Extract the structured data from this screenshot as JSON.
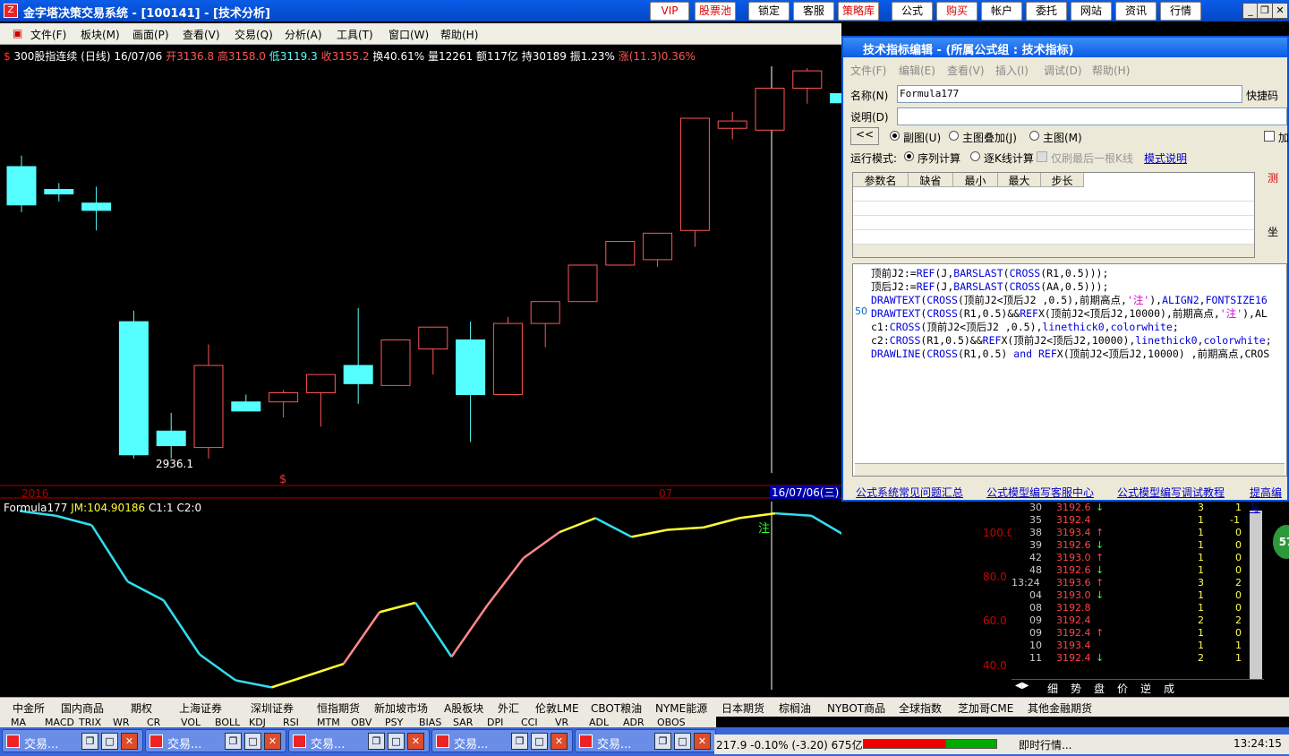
{
  "titlebar": {
    "app_icon": "Z",
    "title": "金字塔决策交易系统 - [100141] - [技术分析]",
    "buttons": [
      "VIP",
      "股票池",
      "锁定",
      "客服",
      "策略库",
      "公式",
      "购买",
      "帐户",
      "委托",
      "网站",
      "资讯",
      "行情"
    ]
  },
  "menu": {
    "items": [
      "文件(F)",
      "板块(M)",
      "画面(P)",
      "查看(V)",
      "交易(Q)",
      "分析(A)",
      "工具(T)",
      "窗口(W)",
      "帮助(H)"
    ]
  },
  "chart": {
    "info": {
      "flag": "$",
      "name": "300股指连续 (日线) 16/07/06",
      "open": "开3136.8",
      "high": "高3158.0",
      "low": "低3119.3",
      "close": "收3155.2",
      "turnover": "换40.61%",
      "volume": "量12261",
      "amount": "额117亿",
      "position": "持30189",
      "amplitude": "振1.23%",
      "change": "涨(11.3)0.36%"
    },
    "low_label": "2936.1",
    "signal_mark": "$",
    "year_label": "2016",
    "month_label": "07",
    "date_label": "16/07/06(三)",
    "indicator": {
      "name": "Formula177",
      "jm": "JM:104.90186",
      "c1": "C1:1",
      "c2": "C2:0",
      "note": "注"
    },
    "y_ticks": [
      "100.0",
      "80.0",
      "60.0",
      "40.0"
    ],
    "colors": {
      "up": "#ff5555",
      "down": "#55ffff",
      "line_cyan": "#33ddee",
      "line_pink": "#ff8888",
      "line_yellow": "#ffff33"
    }
  },
  "chart_data": {
    "type": "candlestick",
    "x": [
      "c1",
      "c2",
      "c3",
      "c4",
      "c5",
      "c6",
      "c7",
      "c8",
      "c9",
      "c10",
      "c11",
      "c12",
      "c13",
      "c14",
      "c15",
      "c16",
      "c17",
      "c18",
      "c19",
      "c20",
      "c21",
      "c22",
      "c23"
    ],
    "ohlc": [
      [
        3050,
        3062,
        3000,
        3008
      ],
      [
        3025,
        3032,
        3012,
        3020
      ],
      [
        3010,
        3028,
        2980,
        3002
      ],
      [
        2880,
        2892,
        2730,
        2734
      ],
      [
        2760,
        2780,
        2730,
        2744
      ],
      [
        2742,
        2855,
        2730,
        2832
      ],
      [
        2792,
        2800,
        2782,
        2782
      ],
      [
        2792,
        2805,
        2775,
        2802
      ],
      [
        2802,
        2820,
        2765,
        2822
      ],
      [
        2832,
        2895,
        2790,
        2812
      ],
      [
        2810,
        2860,
        2810,
        2860
      ],
      [
        2850,
        2862,
        2822,
        2874
      ],
      [
        2860,
        2880,
        2748,
        2800
      ],
      [
        2800,
        2885,
        2800,
        2878
      ],
      [
        2878,
        2898,
        2852,
        2902
      ],
      [
        2902,
        2925,
        2902,
        2942
      ],
      [
        2942,
        2966,
        2950,
        2968
      ],
      [
        2948,
        2972,
        2940,
        2977
      ],
      [
        2980,
        3006,
        2962,
        3103
      ],
      [
        3092,
        3110,
        3080,
        3100
      ],
      [
        3090,
        3113,
        3090,
        3136
      ],
      [
        3136,
        3158,
        3119,
        3155
      ],
      [
        3130,
        3132,
        3120,
        3120
      ]
    ],
    "indicator_series": [
      {
        "name": "Formula177",
        "values": [
          106,
          104,
          100,
          76,
          68,
          45,
          34,
          31,
          36,
          41,
          63,
          67,
          44,
          66,
          86,
          97,
          103,
          95,
          98,
          99,
          103,
          105,
          104,
          95,
          72,
          81
        ]
      }
    ],
    "ylim_indicator": [
      30,
      110
    ]
  },
  "ticks": {
    "rows": [
      {
        "t": "30",
        "p": "3192.6",
        "a": "↓",
        "v": "3",
        "d": "1"
      },
      {
        "t": "35",
        "p": "3192.4",
        "a": "",
        "v": "1",
        "d": "-1"
      },
      {
        "t": "38",
        "p": "3193.4",
        "a": "↑",
        "v": "1",
        "d": "0"
      },
      {
        "t": "39",
        "p": "3192.6",
        "a": "↓",
        "v": "1",
        "d": "0"
      },
      {
        "t": "42",
        "p": "3193.0",
        "a": "↑",
        "v": "1",
        "d": "0"
      },
      {
        "t": "48",
        "p": "3192.6",
        "a": "↓",
        "v": "1",
        "d": "0"
      },
      {
        "t": "13:24",
        "p": "3193.6",
        "a": "↑",
        "v": "3",
        "d": "2"
      },
      {
        "t": "04",
        "p": "3193.0",
        "a": "↓",
        "v": "1",
        "d": "0"
      },
      {
        "t": "08",
        "p": "3192.8",
        "a": "",
        "v": "1",
        "d": "0"
      },
      {
        "t": "09",
        "p": "3192.4",
        "a": "",
        "v": "2",
        "d": "2"
      },
      {
        "t": "09",
        "p": "3192.4",
        "a": "↑",
        "v": "1",
        "d": "0"
      },
      {
        "t": "10",
        "p": "3193.4",
        "a": "",
        "v": "1",
        "d": "1"
      },
      {
        "t": "11",
        "p": "3192.4",
        "a": "↓",
        "v": "2",
        "d": "1"
      }
    ],
    "tabs": [
      "细",
      "势",
      "盘",
      "价",
      "逆",
      "成"
    ],
    "badge": "57"
  },
  "tabs": [
    "中金所",
    "国内商品",
    "期权",
    "上海证券",
    "深圳证券",
    "恒指期货",
    "新加坡市场",
    "A股板块",
    "外汇",
    "伦敦LME",
    "CBOT粮油",
    "NYME能源",
    "日本期货",
    "棕榈油",
    "NYBOT商品",
    "全球指数",
    "芝加哥CME",
    "其他金融期货"
  ],
  "indicators_bar": [
    "MA",
    "MACD",
    "TRIX",
    "WR",
    "CR",
    "VOL",
    "BOLL",
    "KDJ",
    "RSI",
    "MTM",
    "OBV",
    "PSY",
    "BIAS",
    "SAR",
    "DPI",
    "CCI",
    "VR",
    "ADL",
    "ADR",
    "OBOS"
  ],
  "taskbar": {
    "items": [
      "交易...",
      "交易...",
      "交易...",
      "交易...",
      "交易..."
    ]
  },
  "status": {
    "quote": "217.9 -0.10% (-3.20) 675亿",
    "realtime": "即时行情...",
    "clock": "13:24:15"
  },
  "editor": {
    "title": "技术指标编辑 - (所属公式组 : 技术指标)",
    "menu": [
      "文件(F)",
      "编辑(E)",
      "查看(V)",
      "插入(I)",
      "调试(D)",
      "帮助(H)"
    ],
    "name_label": "名称(N)",
    "name_value": "Formula177",
    "shortcut": "快捷码",
    "desc_label": "说明(D)",
    "back": "<<",
    "chart_types": [
      "副图(U)",
      "主图叠加(J)",
      "主图(M)"
    ],
    "add_label": "加",
    "run_mode": "运行模式:",
    "modes": [
      "序列计算",
      "逐K线计算"
    ],
    "last_bar": "仅刷最后一根K线",
    "mode_help": "模式说明",
    "param_headers": [
      "参数名",
      "缺省",
      "最小",
      "最大",
      "步长"
    ],
    "test": "测",
    "coord": "坐",
    "line_number": "50",
    "code": [
      "顶前J2:=REF(J,BARSLAST(CROSS(R1,0.5)));",
      "顶后J2:=REF(J,BARSLAST(CROSS(AA,0.5)));",
      "DRAWTEXT(CROSS(顶前J2<顶后J2 ,0.5),前期高点,'注'),ALIGN2,FONTSIZE16",
      "DRAWTEXT(CROSS(R1,0.5)&&REFX(顶前J2<顶后J2,10000),前期高点,'注'),AL",
      "c1:CROSS(顶前J2<顶后J2 ,0.5),linethick0,colorwhite;",
      "c2:CROSS(R1,0.5)&&REFX(顶前J2<顶后J2,10000),linethick0,colorwhite;",
      "DRAWLINE(CROSS(R1,0.5) and REFX(顶前J2<顶后J2,10000) ,前期高点,CROS"
    ],
    "links": [
      "公式系统常见问题汇总",
      "公式模型编写客服中心",
      "公式模型编写调试教程",
      "提高编写"
    ]
  }
}
